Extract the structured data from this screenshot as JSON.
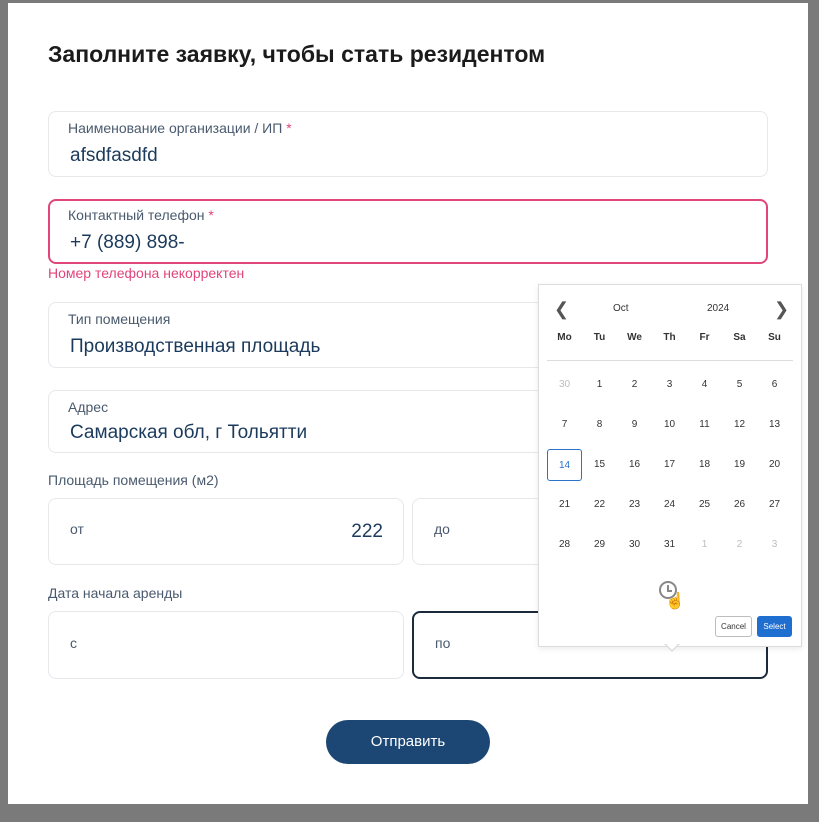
{
  "form": {
    "title": "Заполните заявку, чтобы стать резидентом",
    "org": {
      "label": "Наименование организации / ИП",
      "required": "*",
      "value": "afsdfasdfd"
    },
    "phone": {
      "label": "Контактный телефон",
      "required": "*",
      "value": "+7 (889) 898-",
      "error": "Номер телефона некорректен"
    },
    "premises_type": {
      "label": "Тип помещения",
      "value": "Производственная площадь"
    },
    "address": {
      "label": "Адрес",
      "value": "Самарская обл, г Тольятти"
    },
    "area": {
      "label": "Площадь помещения (м2)",
      "from_label": "от",
      "from_value": "222",
      "to_label": "до"
    },
    "rent_start": {
      "label": "Дата начала аренды",
      "from_label": "с",
      "to_label": "по"
    },
    "submit_label": "Отправить"
  },
  "datepicker": {
    "month": "Oct",
    "year": "2024",
    "weekdays": [
      "Mo",
      "Tu",
      "We",
      "Th",
      "Fr",
      "Sa",
      "Su"
    ],
    "weeks": [
      [
        "30",
        "1",
        "2",
        "3",
        "4",
        "5",
        "6"
      ],
      [
        "7",
        "8",
        "9",
        "10",
        "11",
        "12",
        "13"
      ],
      [
        "14",
        "15",
        "16",
        "17",
        "18",
        "19",
        "20"
      ],
      [
        "21",
        "22",
        "23",
        "24",
        "25",
        "26",
        "27"
      ],
      [
        "28",
        "29",
        "30",
        "31",
        "1",
        "2",
        "3"
      ]
    ],
    "muted": [
      [
        0,
        0
      ],
      [
        4,
        4
      ],
      [
        4,
        5
      ],
      [
        4,
        6
      ]
    ],
    "today": [
      2,
      0
    ],
    "cancel_label": "Cancel",
    "select_label": "Select",
    "accent": "#2a73c8"
  }
}
